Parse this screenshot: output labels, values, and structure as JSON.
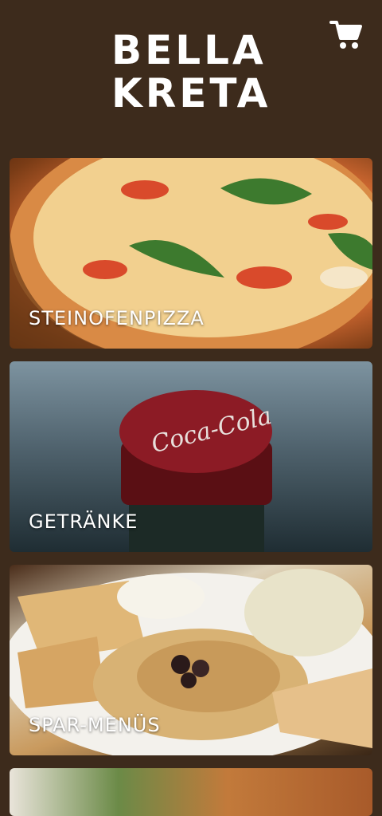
{
  "brand": {
    "line1": "BELLA",
    "line2": "KRETA"
  },
  "header": {
    "cart_icon": "shopping-cart-icon"
  },
  "categories": [
    {
      "label": "STEINOFENPIZZA"
    },
    {
      "label": "GETRÄNKE"
    },
    {
      "label": "SPAR-MENÜS"
    },
    {
      "label": ""
    }
  ],
  "colors": {
    "background": "#3d2b1c",
    "text": "#ffffff"
  }
}
